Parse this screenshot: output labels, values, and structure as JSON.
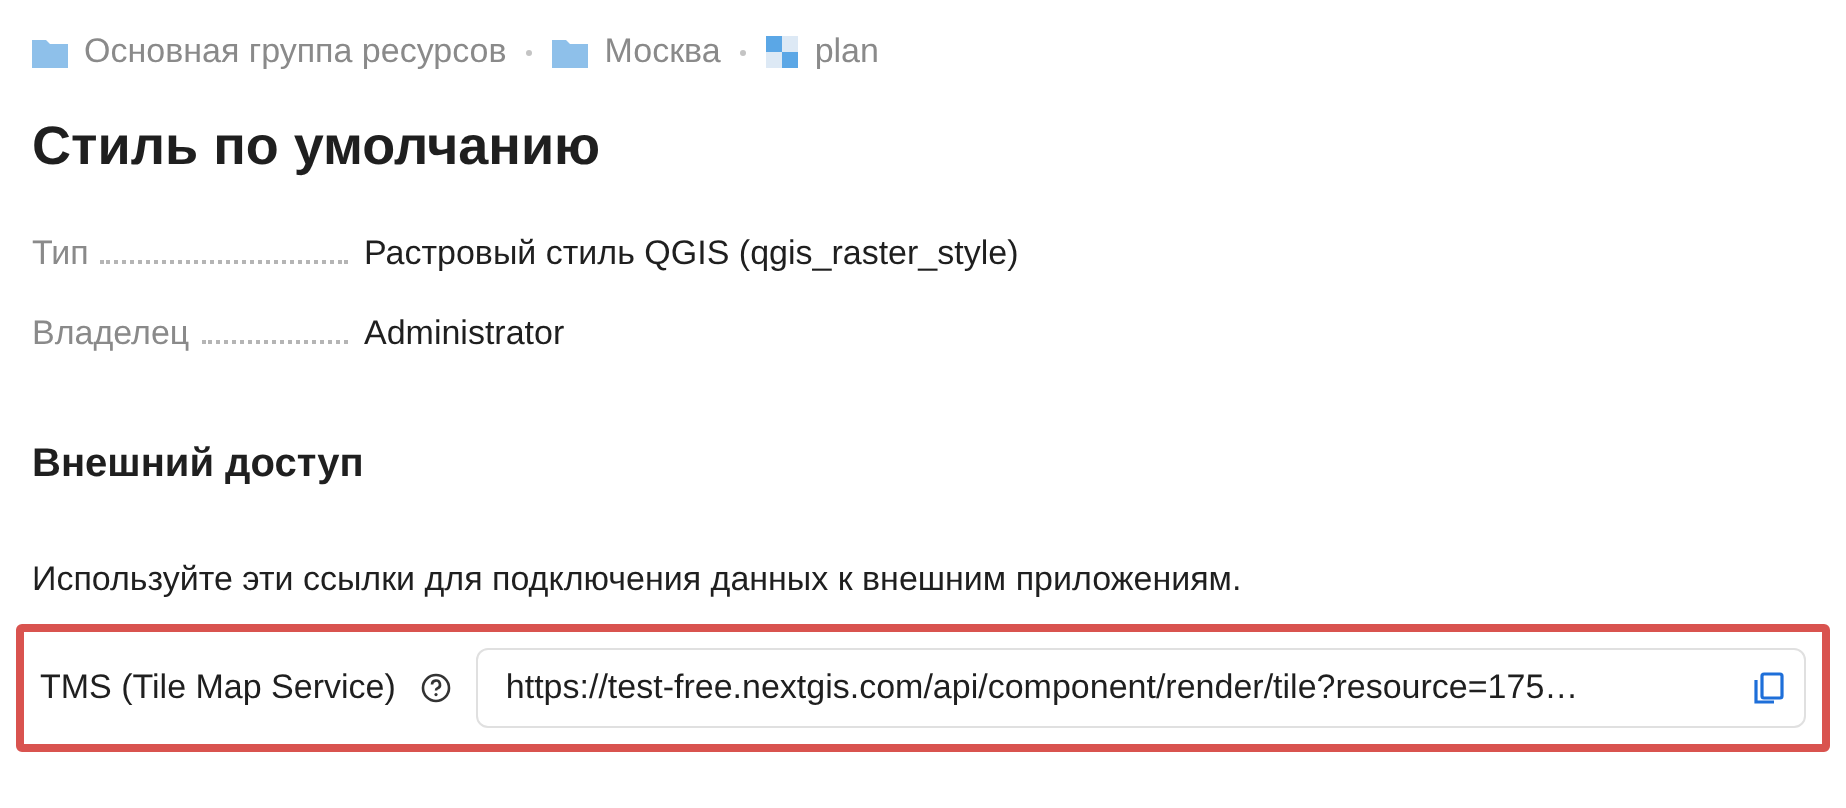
{
  "breadcrumb": [
    {
      "label": "Основная группа ресурсов",
      "kind": "folder"
    },
    {
      "label": "Москва",
      "kind": "folder"
    },
    {
      "label": "plan",
      "kind": "raster"
    }
  ],
  "title": "Стиль по умолчанию",
  "properties": [
    {
      "label": "Тип",
      "value": "Растровый стиль QGIS (qgis_raster_style)"
    },
    {
      "label": "Владелец",
      "value": "Administrator"
    }
  ],
  "external_access": {
    "heading": "Внешний доступ",
    "description": "Используйте эти ссылки для подключения данных к внешним приложениям.",
    "links": [
      {
        "label": "TMS (Tile Map Service)",
        "value": "https://test-free.nextgis.com/api/component/render/tile?resource=175…",
        "highlighted": true
      }
    ]
  }
}
